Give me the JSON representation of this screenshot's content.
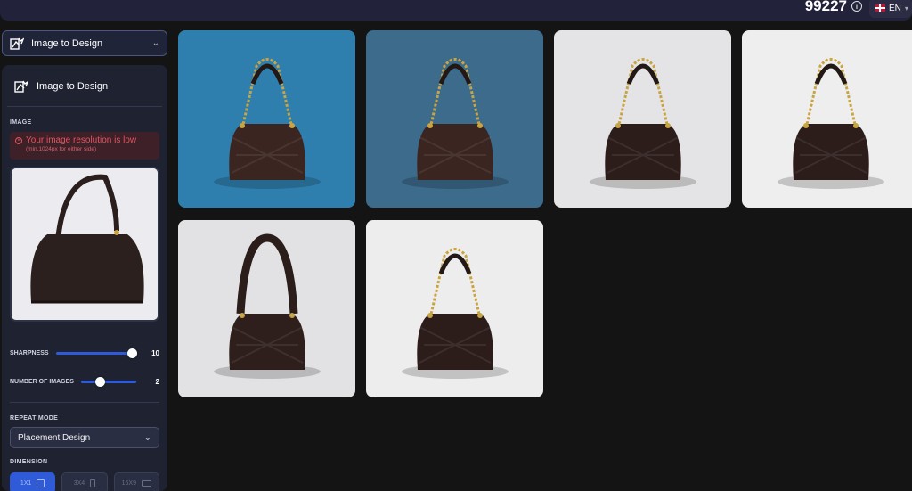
{
  "header": {
    "credits": "99227",
    "language": "EN"
  },
  "tool_selector": {
    "label": "Image to Design"
  },
  "panel": {
    "title": "Image to Design",
    "image_section_label": "IMAGE",
    "warning": {
      "title": "Your image resolution is low",
      "subtitle": "(min.1024px for either side)"
    },
    "sharpness": {
      "label": "SHARPNESS",
      "value": "10",
      "fraction": 1.0
    },
    "num_images": {
      "label": "NUMBER OF IMAGES",
      "value": "2",
      "fraction": 0.35
    },
    "repeat_mode": {
      "label": "REPEAT MODE",
      "selected": "Placement Design"
    },
    "dimension": {
      "label": "DIMENSION",
      "options": [
        {
          "label": "1X1",
          "active": true
        },
        {
          "label": "3X4",
          "active": false
        },
        {
          "label": "16X9",
          "active": false
        }
      ]
    }
  },
  "results": [
    {
      "name": "result-image-1",
      "bg": "#2f7fae",
      "bag": "#3a2520",
      "chain": true
    },
    {
      "name": "result-image-2",
      "bg": "#3d6b8c",
      "bag": "#3a2520",
      "chain": true
    },
    {
      "name": "result-image-3",
      "bg": "#e4e4e6",
      "bag": "#2c1d1b",
      "chain": true
    },
    {
      "name": "result-image-4",
      "bg": "#eeeeee",
      "bag": "#2c1d1b",
      "chain": true
    },
    {
      "name": "result-image-5",
      "bg": "#e2e2e4",
      "bag": "#2e1f1c",
      "chain": false
    },
    {
      "name": "result-image-6",
      "bg": "#ededed",
      "bag": "#2c1d1b",
      "chain": true
    }
  ],
  "colors": {
    "accent": "#2f5bd9",
    "warning": "#e2555f"
  }
}
